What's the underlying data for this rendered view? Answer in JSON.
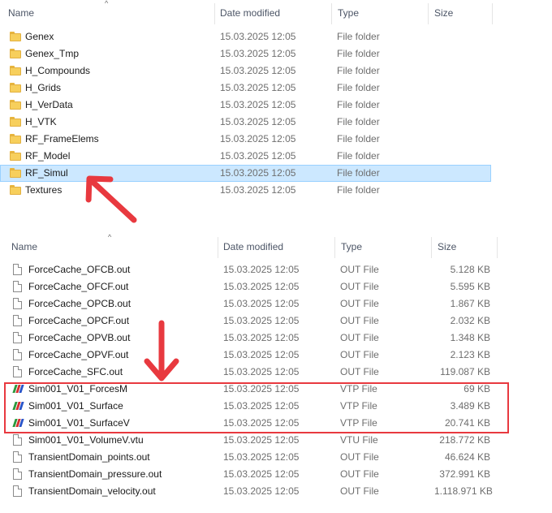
{
  "columns": {
    "name": "Name",
    "date_modified": "Date modified",
    "type": "Type",
    "size": "Size"
  },
  "folders_pane": {
    "rows": [
      {
        "name": "Genex",
        "date": "15.03.2025 12:05",
        "type": "File folder"
      },
      {
        "name": "Genex_Tmp",
        "date": "15.03.2025 12:05",
        "type": "File folder"
      },
      {
        "name": "H_Compounds",
        "date": "15.03.2025 12:05",
        "type": "File folder"
      },
      {
        "name": "H_Grids",
        "date": "15.03.2025 12:05",
        "type": "File folder"
      },
      {
        "name": "H_VerData",
        "date": "15.03.2025 12:05",
        "type": "File folder"
      },
      {
        "name": "H_VTK",
        "date": "15.03.2025 12:05",
        "type": "File folder"
      },
      {
        "name": "RF_FrameElems",
        "date": "15.03.2025 12:05",
        "type": "File folder"
      },
      {
        "name": "RF_Model",
        "date": "15.03.2025 12:05",
        "type": "File folder"
      },
      {
        "name": "RF_Simul",
        "date": "15.03.2025 12:05",
        "type": "File folder",
        "selected": true
      },
      {
        "name": "Textures",
        "date": "15.03.2025 12:05",
        "type": "File folder"
      }
    ]
  },
  "files_pane": {
    "rows": [
      {
        "name": "ForceCache_OFCB.out",
        "date": "15.03.2025 12:05",
        "type": "OUT File",
        "size": "5.128 KB",
        "icon": "file-icon"
      },
      {
        "name": "ForceCache_OFCF.out",
        "date": "15.03.2025 12:05",
        "type": "OUT File",
        "size": "5.595 KB",
        "icon": "file-icon"
      },
      {
        "name": "ForceCache_OPCB.out",
        "date": "15.03.2025 12:05",
        "type": "OUT File",
        "size": "1.867 KB",
        "icon": "file-icon"
      },
      {
        "name": "ForceCache_OPCF.out",
        "date": "15.03.2025 12:05",
        "type": "OUT File",
        "size": "2.032 KB",
        "icon": "file-icon"
      },
      {
        "name": "ForceCache_OPVB.out",
        "date": "15.03.2025 12:05",
        "type": "OUT File",
        "size": "1.348 KB",
        "icon": "file-icon"
      },
      {
        "name": "ForceCache_OPVF.out",
        "date": "15.03.2025 12:05",
        "type": "OUT File",
        "size": "2.123 KB",
        "icon": "file-icon"
      },
      {
        "name": "ForceCache_SFC.out",
        "date": "15.03.2025 12:05",
        "type": "OUT File",
        "size": "119.087 KB",
        "icon": "file-icon"
      },
      {
        "name": "Sim001_V01_ForcesM",
        "date": "15.03.2025 12:05",
        "type": "VTP File",
        "size": "69 KB",
        "icon": "vtp-icon"
      },
      {
        "name": "Sim001_V01_Surface",
        "date": "15.03.2025 12:05",
        "type": "VTP File",
        "size": "3.489 KB",
        "icon": "vtp-icon"
      },
      {
        "name": "Sim001_V01_SurfaceV",
        "date": "15.03.2025 12:05",
        "type": "VTP File",
        "size": "20.741 KB",
        "icon": "vtp-icon"
      },
      {
        "name": "Sim001_V01_VolumeV.vtu",
        "date": "15.03.2025 12:05",
        "type": "VTU File",
        "size": "218.772 KB",
        "icon": "file-icon"
      },
      {
        "name": "TransientDomain_points.out",
        "date": "15.03.2025 12:05",
        "type": "OUT File",
        "size": "46.624 KB",
        "icon": "file-icon"
      },
      {
        "name": "TransientDomain_pressure.out",
        "date": "15.03.2025 12:05",
        "type": "OUT File",
        "size": "372.991 KB",
        "icon": "file-icon"
      },
      {
        "name": "TransientDomain_velocity.out",
        "date": "15.03.2025 12:05",
        "type": "OUT File",
        "size": "1.118.971 KB",
        "icon": "file-icon"
      }
    ]
  },
  "colors": {
    "annotation_red": "#e8393f",
    "selection_bg": "#cce8ff",
    "selection_border": "#99d1ff",
    "folder_yellow": "#f7cf5c"
  },
  "icons": {
    "sort_indicator": "^"
  }
}
